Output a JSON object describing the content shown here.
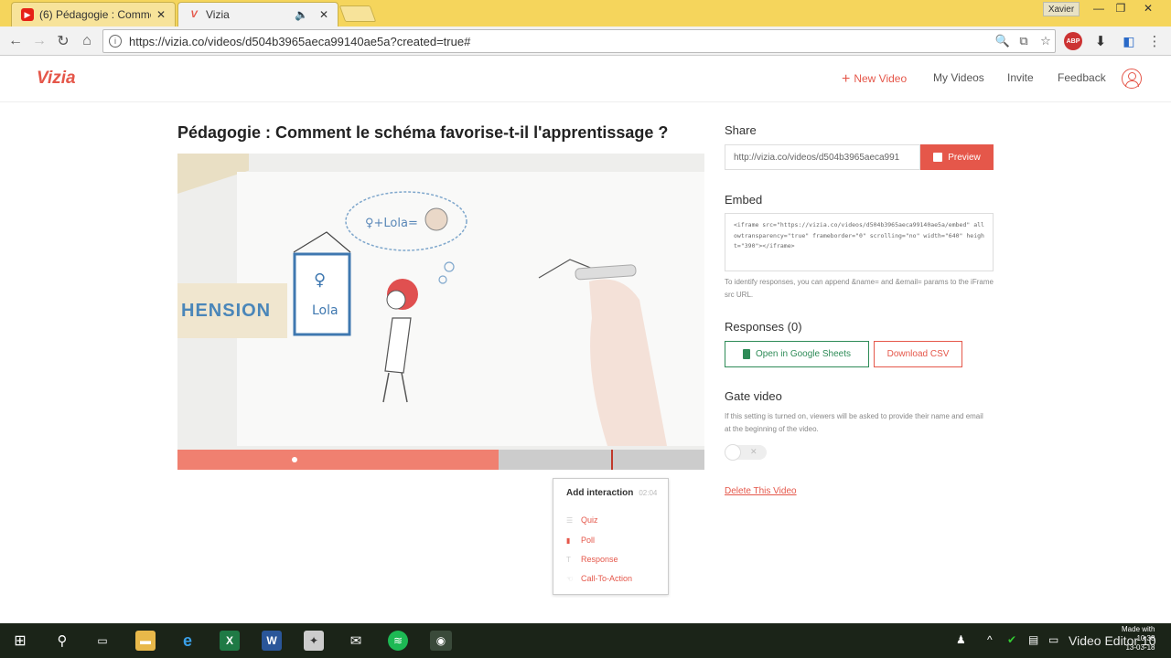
{
  "browser": {
    "tabs": [
      {
        "title": "(6) Pédagogie : Commen",
        "favicon": "youtube-icon",
        "active": false
      },
      {
        "title": "Vizia",
        "favicon": "vizia-icon",
        "active": true
      }
    ],
    "profile_name": "Xavier",
    "url": "https://vizia.co/videos/d504b3965aeca99140ae5a?created=true#",
    "extension_badge": "4"
  },
  "app": {
    "logo": "Vizia",
    "nav": {
      "new_video": "New Video",
      "my_videos": "My Videos",
      "invite": "Invite",
      "feedback": "Feedback"
    }
  },
  "video": {
    "title": "Pédagogie : Comment le schéma favorise-t-il l'apprentissage ?",
    "frame_text": "HENSION",
    "progress_fraction": 0.61
  },
  "interaction_popup": {
    "heading": "Add interaction",
    "time": "02:04",
    "items": [
      "Quiz",
      "Poll",
      "Response",
      "Call-To-Action"
    ]
  },
  "share": {
    "label": "Share",
    "url": "http://vizia.co/videos/d504b3965aeca991",
    "preview_label": "Preview"
  },
  "embed": {
    "label": "Embed",
    "code": "<iframe src=\"https://vizia.co/videos/d504b3965aeca99140ae5a/embed\" allowtransparency=\"true\" frameborder=\"0\" scrolling=\"no\" width=\"640\" height=\"390\"></iframe>",
    "note": "To identify responses, you can append &name= and &email= params to the iFrame src URL."
  },
  "responses": {
    "label": "Responses (0)",
    "sheets_button": "Open in Google Sheets",
    "csv_button": "Download CSV"
  },
  "gate": {
    "label": "Gate video",
    "note": "If this setting is turned on, viewers will be asked to provide their name and email at the beginning of the video.",
    "enabled": false
  },
  "delete_link": "Delete This Video",
  "taskbar": {
    "watermark": "Video Editor 10",
    "made_with": "Made with",
    "time": "10:38",
    "date": "13-03-18"
  },
  "colors": {
    "accent": "#e5574a",
    "tab_strip": "#f5d55c",
    "sheets_green": "#2e8b57",
    "progress_fill": "#f08070"
  }
}
